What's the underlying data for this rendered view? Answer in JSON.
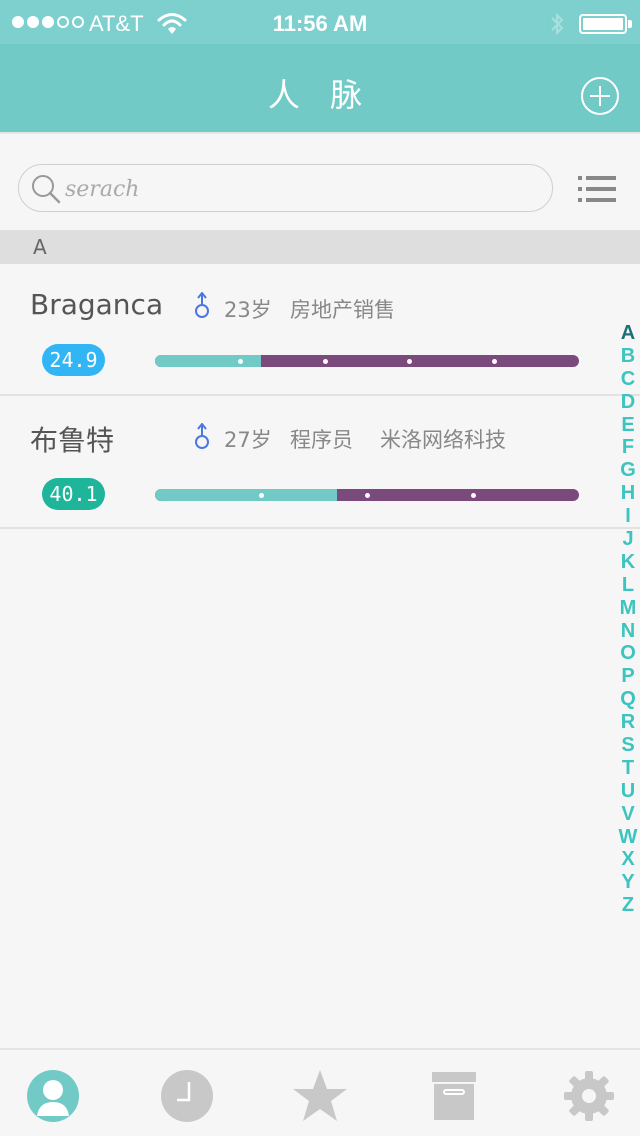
{
  "status_bar": {
    "carrier": "AT&T",
    "time": "11:56 AM",
    "signal_bars_full": 3,
    "signal_bars_total": 5
  },
  "nav": {
    "title": "人 脉",
    "add_icon": "plus-circle-icon"
  },
  "search": {
    "placeholder": "serach",
    "value": "",
    "search_icon": "search-icon",
    "list_icon": "list-view-icon"
  },
  "section": {
    "letter": "A"
  },
  "contacts": [
    {
      "name": "Braganca",
      "gender_icon": "male-icon",
      "age": "23岁",
      "job": "房地产销售",
      "company": "",
      "score": "24.9",
      "score_color": "#31b5f5",
      "progress": 0.25,
      "marks": [
        0.2,
        0.4,
        0.6,
        0.8
      ]
    },
    {
      "name": "布鲁特",
      "gender_icon": "male-icon",
      "age": "27岁",
      "job": "程序员",
      "company": "米洛网络科技",
      "score": "40.1",
      "score_color": "#1eb59a",
      "progress": 0.43,
      "marks": [
        0.25,
        0.5,
        0.75
      ]
    }
  ],
  "index_letters": [
    "A",
    "B",
    "C",
    "D",
    "E",
    "F",
    "G",
    "H",
    "I",
    "J",
    "K",
    "L",
    "M",
    "N",
    "O",
    "P",
    "Q",
    "R",
    "S",
    "T",
    "U",
    "V",
    "W",
    "X",
    "Y",
    "Z"
  ],
  "index_active": "A",
  "tabs": [
    {
      "name": "contacts",
      "icon": "contacts-avatar-icon",
      "active": true
    },
    {
      "name": "history",
      "icon": "clock-icon",
      "active": false
    },
    {
      "name": "favorites",
      "icon": "star-icon",
      "active": false
    },
    {
      "name": "archive",
      "icon": "archive-box-icon",
      "active": false
    },
    {
      "name": "settings",
      "icon": "gear-icon",
      "active": false
    }
  ],
  "colors": {
    "header": "#72cac7",
    "progress_fill": "#72cac7",
    "progress_track": "#7a4a7d",
    "index": "#3cc4c0",
    "tab_active": "#72cac7",
    "tab_inactive": "#c8c8c8"
  }
}
